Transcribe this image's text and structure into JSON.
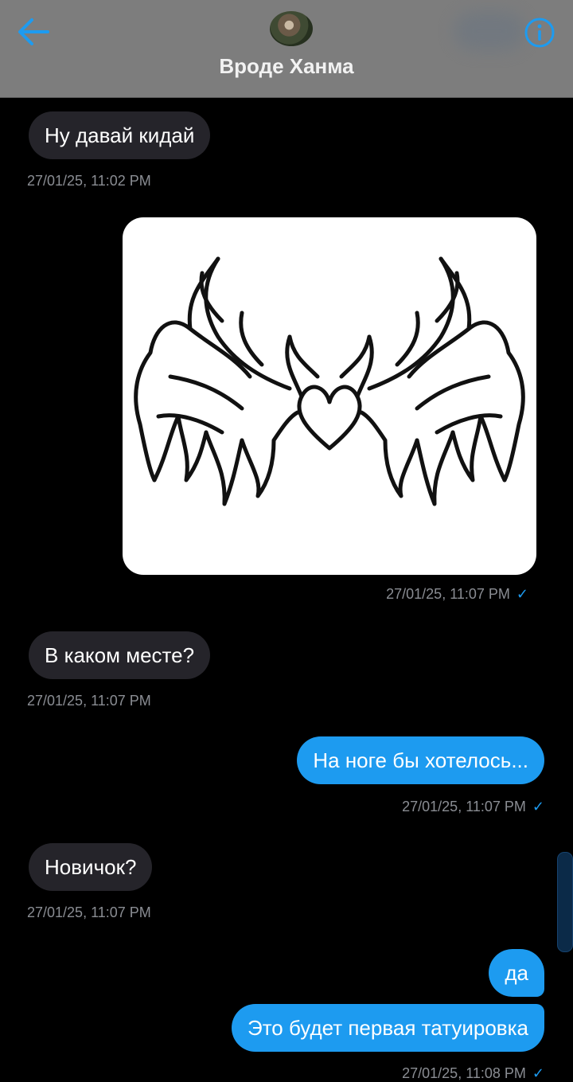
{
  "header": {
    "title": "Вроде Ханма",
    "back_icon": "arrow-left-icon",
    "info_icon": "info-icon",
    "accent_color": "#1d9bf0"
  },
  "messages": [
    {
      "direction": "incoming",
      "type": "text",
      "text": "Ну давай кидай",
      "timestamp": "27/01/25, 11:02 PM"
    },
    {
      "direction": "outgoing",
      "type": "image",
      "image": "tribal-wings-tattoo-sketch",
      "timestamp": "27/01/25, 11:07 PM",
      "read": true
    },
    {
      "direction": "incoming",
      "type": "text",
      "text": "В каком месте?",
      "timestamp": "27/01/25, 11:07 PM"
    },
    {
      "direction": "outgoing",
      "type": "text",
      "text": "На ноге бы хотелось...",
      "timestamp": "27/01/25, 11:07 PM",
      "read": true
    },
    {
      "direction": "incoming",
      "type": "text",
      "text": "Новичок?",
      "timestamp": "27/01/25, 11:07 PM"
    },
    {
      "direction": "outgoing",
      "type": "text",
      "text": "да",
      "timestamp": "",
      "read": false
    },
    {
      "direction": "outgoing",
      "type": "text",
      "text": "Это будет первая татуировка",
      "timestamp": "27/01/25, 11:08 PM",
      "read": true
    }
  ],
  "colors": {
    "background": "#000000",
    "incoming_bubble": "#25242a",
    "outgoing_bubble": "#1d9bf0",
    "header_bg": "#7d7d7d",
    "timestamp": "#8a8d93"
  }
}
